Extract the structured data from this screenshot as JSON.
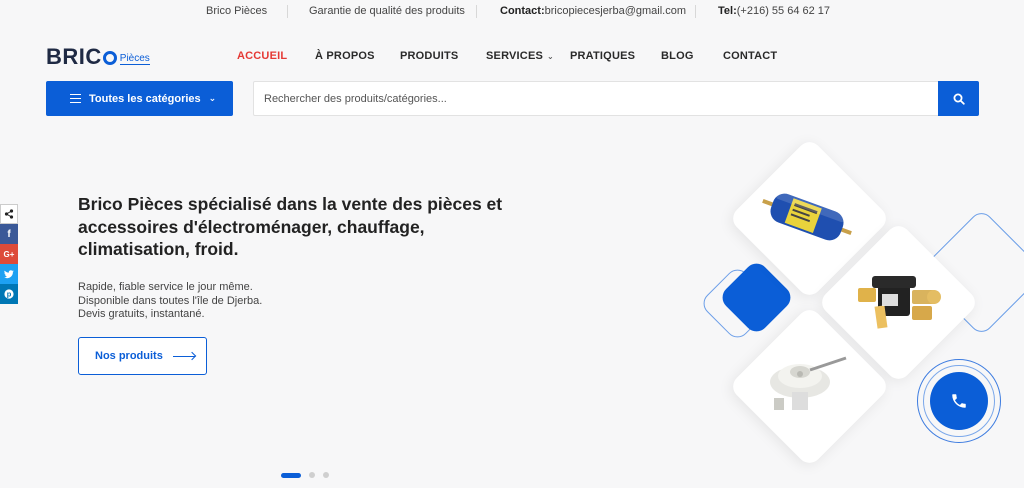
{
  "topbar": {
    "brand": "Brico Pièces",
    "quality": "Garantie de qualité des produits",
    "contact_label": "Contact:",
    "contact_email": "bricopiecesjerba@gmail.com",
    "tel_label": "Tel:",
    "tel_value": "(+216) 55 64 62 17"
  },
  "logo": {
    "text_main": "BRIC",
    "text_sub": "Pièces"
  },
  "nav": {
    "items": [
      {
        "label": "ACCUEIL",
        "active": true
      },
      {
        "label": "À PROPOS"
      },
      {
        "label": "PRODUITS"
      },
      {
        "label": "SERVICES",
        "has_dropdown": true
      },
      {
        "label": "PRATIQUES"
      },
      {
        "label": "BLOG"
      },
      {
        "label": "CONTACT"
      }
    ]
  },
  "categories_button": {
    "label": "Toutes les catégories"
  },
  "search": {
    "placeholder": "Rechercher des produits/catégories..."
  },
  "social": [
    "share-icon",
    "facebook-icon",
    "google-plus-icon",
    "twitter-icon",
    "pinterest-icon"
  ],
  "hero": {
    "title": "Brico Pièces spécialisé dans la vente des pièces et accessoires d'électroménager, chauffage, climatisation, froid.",
    "lines": [
      "Rapide, fiable service le jour même.",
      "Disponible dans toutes l'île de Djerba.",
      "Devis gratuits, instantané."
    ],
    "cta": "Nos produits"
  },
  "carousel": {
    "active_slide": 1,
    "slide_count": 3
  },
  "colors": {
    "accent": "#0b5ed7",
    "active_nav": "#e53935"
  }
}
